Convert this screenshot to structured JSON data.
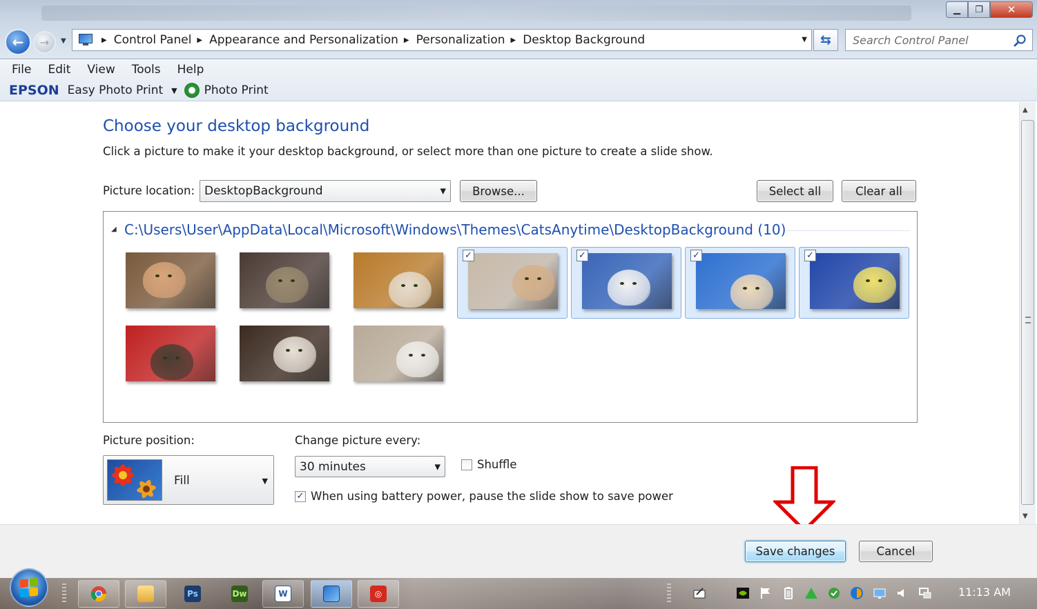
{
  "address": {
    "crumbs": [
      "Control Panel",
      "Appearance and Personalization",
      "Personalization",
      "Desktop Background"
    ]
  },
  "search": {
    "placeholder": "Search Control Panel"
  },
  "menu": {
    "items": [
      "File",
      "Edit",
      "View",
      "Tools",
      "Help"
    ]
  },
  "epson": {
    "logo": "EPSON",
    "app": "Easy Photo Print",
    "print": "Photo Print"
  },
  "page": {
    "heading": "Choose your desktop background",
    "subtext": "Click a picture to make it your desktop background, or select more than one picture to create a slide show."
  },
  "location": {
    "label": "Picture location:",
    "value": "DesktopBackground",
    "browse": "Browse...",
    "select_all": "Select all",
    "clear_all": "Clear all"
  },
  "gallery": {
    "group_title": "C:\\Users\\User\\AppData\\Local\\Microsoft\\Windows\\Themes\\CatsAnytime\\DesktopBackground (10)",
    "thumbnails": [
      {
        "selected": false,
        "bg": "#7a5a3c",
        "cat": "#d9a57a"
      },
      {
        "selected": false,
        "bg": "#4a3a34",
        "cat": "#9a8a70"
      },
      {
        "selected": false,
        "bg": "#b87a2a",
        "cat": "#e6dccd"
      },
      {
        "selected": true,
        "bg": "#c8b9a8",
        "cat": "#d4b08a"
      },
      {
        "selected": true,
        "bg": "#3a66b8",
        "cat": "#f2f2f2"
      },
      {
        "selected": true,
        "bg": "#2e70d0",
        "cat": "#efd8b8"
      },
      {
        "selected": true,
        "bg": "#2346a8",
        "cat": "#f0e06a"
      },
      {
        "selected": false,
        "bg": "#c02020",
        "cat": "#4a3d33"
      },
      {
        "selected": false,
        "bg": "#3b2a20",
        "cat": "#e8e0d8"
      },
      {
        "selected": false,
        "bg": "#b8aa98",
        "cat": "#efece8"
      }
    ]
  },
  "position": {
    "label": "Picture position:",
    "value": "Fill"
  },
  "interval": {
    "label": "Change picture every:",
    "value": "30 minutes",
    "shuffle": "Shuffle",
    "shuffle_checked": false,
    "battery": "When using battery power, pause the slide show to save power",
    "battery_checked": true
  },
  "actions": {
    "save": "Save changes",
    "cancel": "Cancel"
  },
  "taskbar": {
    "apps": [
      "chrome",
      "explorer",
      "photoshop",
      "dreamweaver",
      "word",
      "control-panel",
      "acrobat"
    ],
    "clock": "11:13 AM"
  },
  "colors": {
    "heading": "#1e4fae",
    "arrow": "#e00000"
  }
}
